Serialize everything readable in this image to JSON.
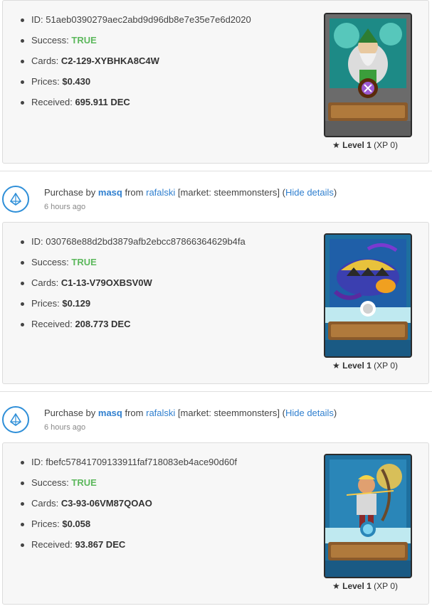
{
  "labels": {
    "id": "ID:",
    "success": "Success:",
    "cards": "Cards:",
    "prices": "Prices:",
    "received": "Received:",
    "purchase_by": "Purchase by",
    "from": "from",
    "market_prefix": "[market: ",
    "market_suffix": "]",
    "hide_open": "(",
    "hide_link": "Hide details",
    "hide_close": ")",
    "level_word": "Level",
    "xp_prefix": "(XP",
    "xp_suffix": ")"
  },
  "transactions": [
    {
      "id": "51aeb0390279aec2abd9d96db8e7e35e7e6d2020",
      "success": "TRUE",
      "cards": "C2-129-XYBHKA8C4W",
      "prices": "$0.430",
      "received": "695.911 DEC",
      "level": "1",
      "xp": "0",
      "card_icon": "wizard-card-icon"
    },
    {
      "buyer": "masq",
      "seller": "rafalski",
      "market": "steemmonsters",
      "time": "6 hours ago",
      "id": "030768e88d2bd3879afb2ebcc87866364629b4fa",
      "success": "TRUE",
      "cards": "C1-13-V79OXBSV0W",
      "prices": "$0.129",
      "received": "208.773 DEC",
      "level": "1",
      "xp": "0",
      "card_icon": "sea-monster-card-icon"
    },
    {
      "buyer": "masq",
      "seller": "rafalski",
      "market": "steemmonsters",
      "time": "6 hours ago",
      "id": "fbefc57841709133911faf718083eb4ace90d60f",
      "success": "TRUE",
      "cards": "C3-93-06VM87QOAO",
      "prices": "$0.058",
      "received": "93.867 DEC",
      "level": "1",
      "xp": "0",
      "card_icon": "archer-card-icon"
    }
  ],
  "colors": {
    "success": "#5cb85c",
    "link": "#2f7fcf",
    "icon_ring": "#2f8fd8"
  }
}
